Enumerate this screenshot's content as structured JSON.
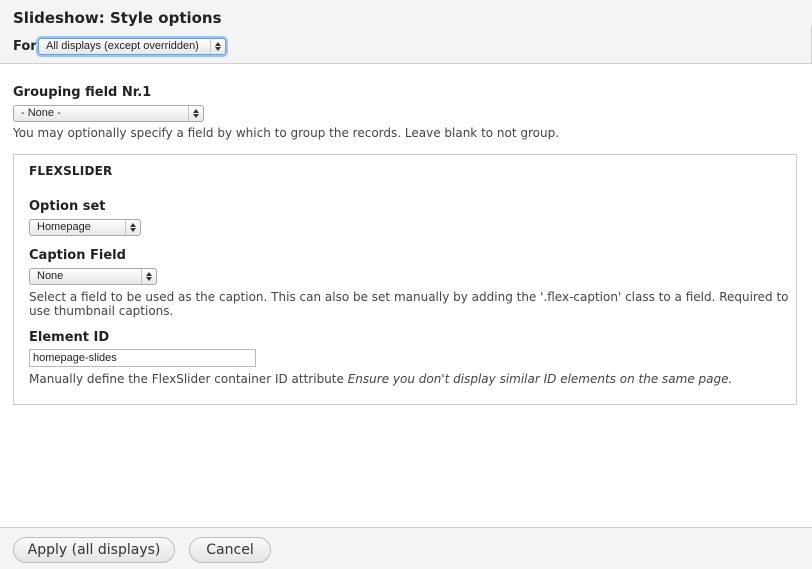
{
  "dialog": {
    "title": "Slideshow: Style options"
  },
  "scope": {
    "label": "For",
    "selected": "All displays (except overridden)"
  },
  "grouping": {
    "label": "Grouping field Nr.1",
    "selected": "- None -",
    "description": "You may optionally specify a field by which to group the records. Leave blank to not group."
  },
  "flexslider": {
    "legend": "FLEXSLIDER",
    "option_set": {
      "label": "Option set",
      "selected": "Homepage"
    },
    "caption_field": {
      "label": "Caption Field",
      "selected": "None",
      "description_line1": "Select a field to be used as the caption. This can also be set manually by adding the '.flex-caption' class to a field. Required to",
      "description_line2": "use thumbnail captions."
    },
    "element_id": {
      "label": "Element ID",
      "value": "homepage-slides",
      "description": "Manually define the FlexSlider container ID attribute",
      "description_emphasis": "Ensure you don't display similar ID elements on the same page."
    }
  },
  "actions": {
    "apply_label": "Apply (all displays)",
    "cancel_label": "Cancel"
  },
  "colors": {
    "header_bg": "#f4f4f4",
    "focus_ring": "#9fc3ee",
    "border": "#cccccc"
  }
}
